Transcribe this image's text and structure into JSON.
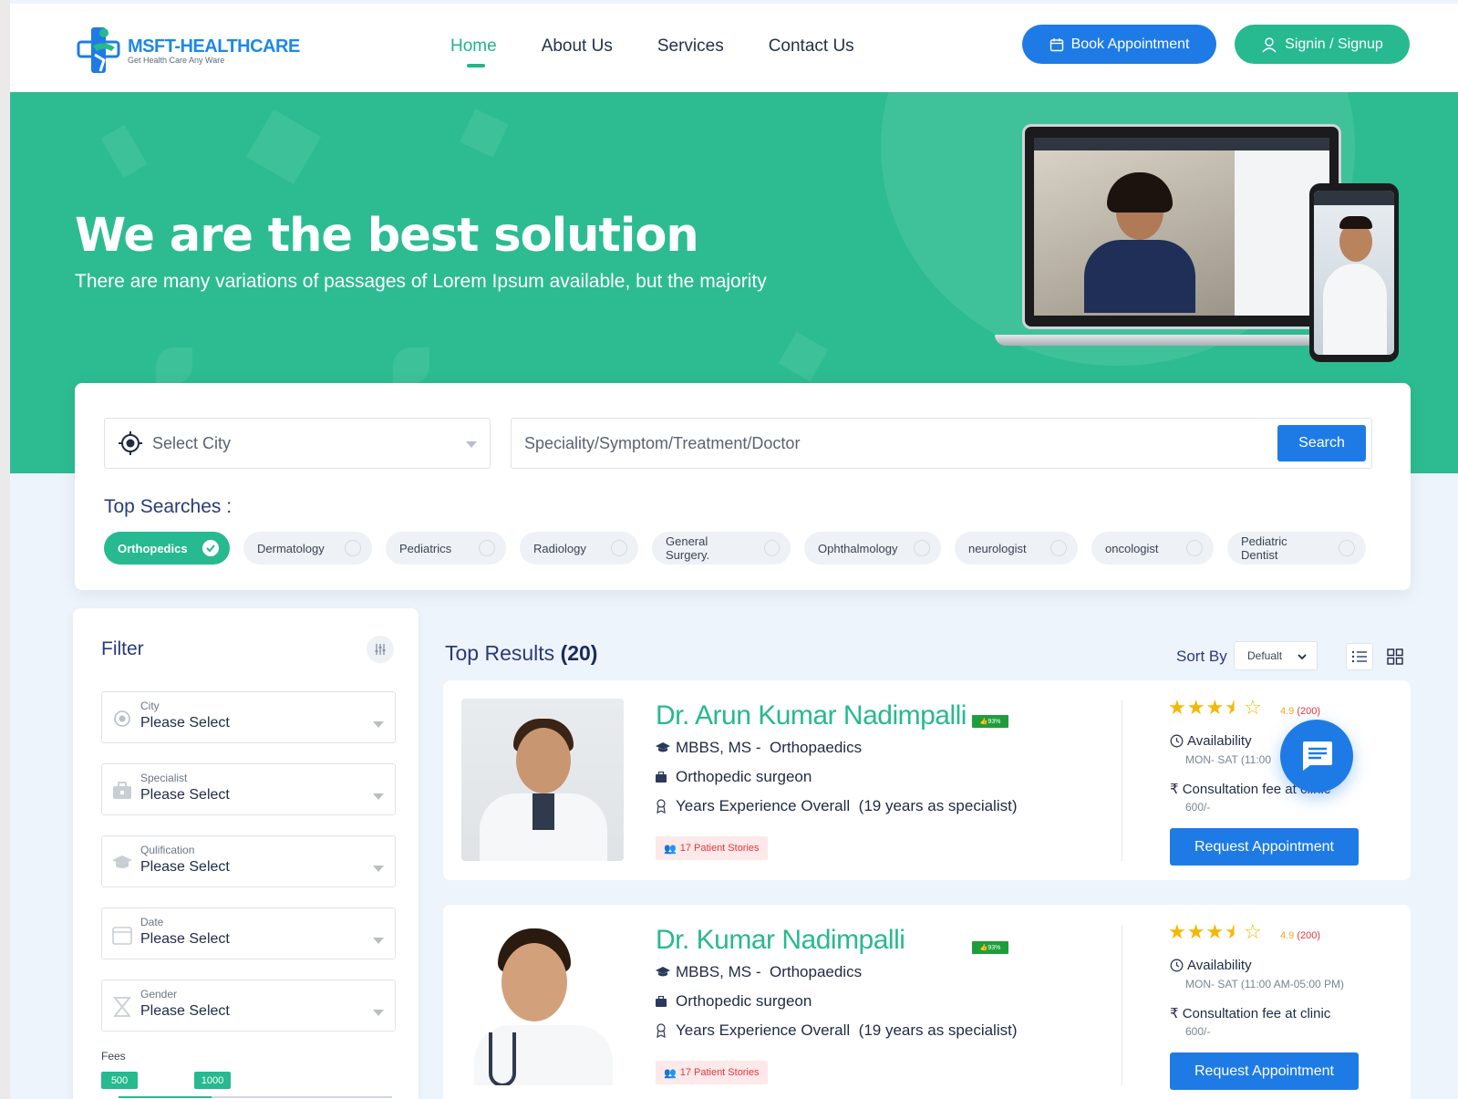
{
  "brand": {
    "name": "MSFT-HEALTHCARE",
    "tagline": "Get Health Care Any Ware",
    "primary_color": "#1e7be6",
    "accent_color": "#27b98f"
  },
  "nav": {
    "items": [
      {
        "label": "Home",
        "active": true
      },
      {
        "label": "About Us",
        "active": false
      },
      {
        "label": "Services",
        "active": false
      },
      {
        "label": "Contact Us",
        "active": false
      }
    ],
    "book_label": "Book Appointment",
    "signin_label": "Signin / Signup"
  },
  "hero": {
    "title": "We are the best solution",
    "subtitle": "There are many variations of passages of Lorem Ipsum available, but the majority"
  },
  "search": {
    "city_placeholder": "Select City",
    "query_placeholder": "Speciality/Symptom/Treatment/Doctor",
    "button_label": "Search",
    "top_searches_label": "Top Searches :",
    "chips": [
      {
        "label": "Orthopedics",
        "active": true
      },
      {
        "label": "Dermatology",
        "active": false
      },
      {
        "label": "Pediatrics",
        "active": false
      },
      {
        "label": "Radiology",
        "active": false
      },
      {
        "label": "General Surgery.",
        "active": false
      },
      {
        "label": "Ophthalmology",
        "active": false
      },
      {
        "label": "neurologist",
        "active": false
      },
      {
        "label": "oncologist",
        "active": false
      },
      {
        "label": "Pediatric Dentist",
        "active": false
      }
    ]
  },
  "filter": {
    "title": "Filter",
    "fields": [
      {
        "label": "City",
        "value": "Please Select"
      },
      {
        "label": "Specialist",
        "value": "Please Select"
      },
      {
        "label": "Qulification",
        "value": "Please Select"
      },
      {
        "label": "Date",
        "value": "Please Select"
      },
      {
        "label": "Gender",
        "value": "Please Select"
      }
    ],
    "fees_label": "Fees",
    "fees_min": "500",
    "fees_max": "1000"
  },
  "results": {
    "title_prefix": "Top Results",
    "count": "(20)",
    "sort_label": "Sort By",
    "sort_value": "Defualt"
  },
  "doctors": [
    {
      "name": "Dr. Arun Kumar Nadimpalli",
      "like_badge": "93%",
      "degree": "MBBS, MS -",
      "speciality": "Orthopaedics",
      "role": "Orthopedic surgeon",
      "experience": "Years Experience Overall",
      "experience_detail": "(19 years as specialist)",
      "stories": "17 Patient Stories",
      "rating": "4.9",
      "rating_count": "(200)",
      "stars": 3.5,
      "availability_label": "Availability",
      "availability_time": "MON- SAT (11:00",
      "fee_label": "Consultation fee at clinic",
      "fee_amount": "600/-",
      "request_label": "Request Appointment"
    },
    {
      "name": "Dr. Kumar Nadimpalli",
      "like_badge": "93%",
      "degree": "MBBS, MS -",
      "speciality": "Orthopaedics",
      "role": "Orthopedic surgeon",
      "experience": "Years Experience Overall",
      "experience_detail": "(19 years as specialist)",
      "stories": "17 Patient Stories",
      "rating": "4.9",
      "rating_count": "(200)",
      "stars": 3.5,
      "availability_label": "Availability",
      "availability_time": "MON- SAT (11:00 AM-05:00 PM)",
      "fee_label": "Consultation fee at clinic",
      "fee_amount": "600/-",
      "request_label": "Request Appointment"
    }
  ],
  "icons": [
    "logo-icon",
    "calendar-icon",
    "user-icon",
    "target-icon",
    "check-icon",
    "sliders-icon",
    "list-view-icon",
    "grid-view-icon",
    "graduation-cap-icon",
    "briefcase-icon",
    "award-icon",
    "users-icon",
    "star-icon",
    "clock-icon",
    "rupee-icon",
    "chat-icon",
    "thumbs-up-icon"
  ]
}
